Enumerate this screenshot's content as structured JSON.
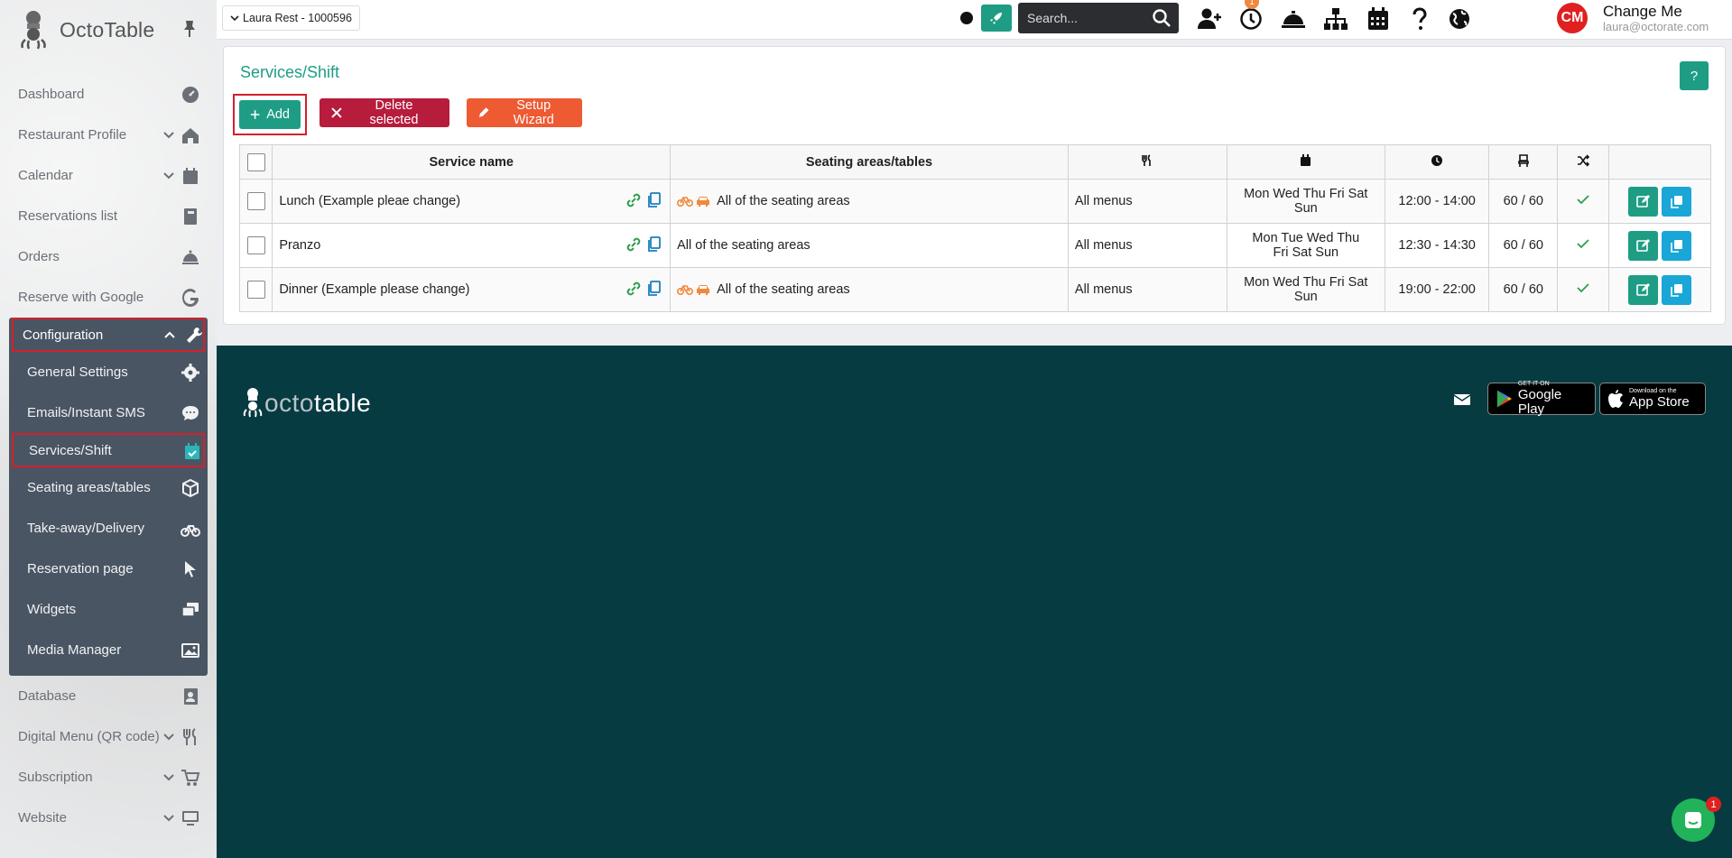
{
  "app": {
    "name": "OctoTable"
  },
  "sidebar": {
    "items_top": [
      {
        "label": "Dashboard",
        "icon": "dashboard-icon",
        "chevron": false
      },
      {
        "label": "Restaurant Profile",
        "icon": "home-icon",
        "chevron": true
      },
      {
        "label": "Calendar",
        "icon": "calendar-icon",
        "chevron": true
      },
      {
        "label": "Reservations list",
        "icon": "book-icon",
        "chevron": false
      },
      {
        "label": "Orders",
        "icon": "bell-icon",
        "chevron": false
      },
      {
        "label": "Reserve with Google",
        "icon": "google-icon",
        "chevron": false
      }
    ],
    "config": {
      "label": "Configuration",
      "items": [
        {
          "label": "General Settings",
          "icon": "gear-icon"
        },
        {
          "label": "Emails/Instant SMS",
          "icon": "chat-bubble-icon"
        },
        {
          "label": "Services/Shift",
          "icon": "calendar-check-icon"
        },
        {
          "label": "Seating areas/tables",
          "icon": "cube-icon"
        },
        {
          "label": "Take-away/Delivery",
          "icon": "bicycle-icon"
        },
        {
          "label": "Reservation page",
          "icon": "pointer-icon"
        },
        {
          "label": "Widgets",
          "icon": "windows-icon"
        },
        {
          "label": "Media Manager",
          "icon": "image-icon"
        }
      ]
    },
    "items_bottom": [
      {
        "label": "Database",
        "icon": "contact-book-icon",
        "chevron": false
      },
      {
        "label": "Digital Menu (QR code)",
        "icon": "utensils-icon",
        "chevron": true
      },
      {
        "label": "Subscription",
        "icon": "cart-icon",
        "chevron": true
      },
      {
        "label": "Website",
        "icon": "monitor-icon",
        "chevron": true
      }
    ]
  },
  "topbar": {
    "restaurant": "Laura Rest - 1000596",
    "search_placeholder": "Search...",
    "notification_count": "1",
    "avatar_initials": "CM",
    "user_name": "Change Me",
    "user_email": "laura@octorate.com"
  },
  "page": {
    "title": "Services/Shift",
    "help_label": "?",
    "add_label": "Add",
    "delete_label": "Delete selected",
    "wizard_label": "Setup Wizard"
  },
  "table": {
    "headers": {
      "service": "Service name",
      "seating": "Seating areas/tables"
    },
    "rows": [
      {
        "name": "Lunch (Example pleae change)",
        "delivery_icons": true,
        "seating": "All of the seating areas",
        "menu": "All menus",
        "days": "Mon Wed Thu Fri Sat Sun",
        "time": "12:00 - 14:00",
        "capacity": "60 / 60"
      },
      {
        "name": "Pranzo",
        "delivery_icons": false,
        "seating": "All of the seating areas",
        "menu": "All menus",
        "days": "Mon Tue Wed Thu Fri Sat Sun",
        "time": "12:30 - 14:30",
        "capacity": "60 / 60"
      },
      {
        "name": "Dinner (Example please change)",
        "delivery_icons": true,
        "seating": "All of the seating areas",
        "menu": "All menus",
        "days": "Mon Wed Thu Fri Sat Sun",
        "time": "19:00 - 22:00",
        "capacity": "60 / 60"
      }
    ]
  },
  "footer": {
    "logo_part1": "octo",
    "logo_part2": "table",
    "google_small": "GET IT ON",
    "google_big": "Google Play",
    "apple_small": "Download on the",
    "apple_big": "App Store"
  },
  "chat": {
    "badge": "1"
  },
  "colors": {
    "brand": "#1e9d84",
    "danger": "#b71c3c",
    "wizard": "#ee5a32",
    "sidebar_group": "#4a5563",
    "footer": "#073b42",
    "highlight": "#d4202b"
  }
}
